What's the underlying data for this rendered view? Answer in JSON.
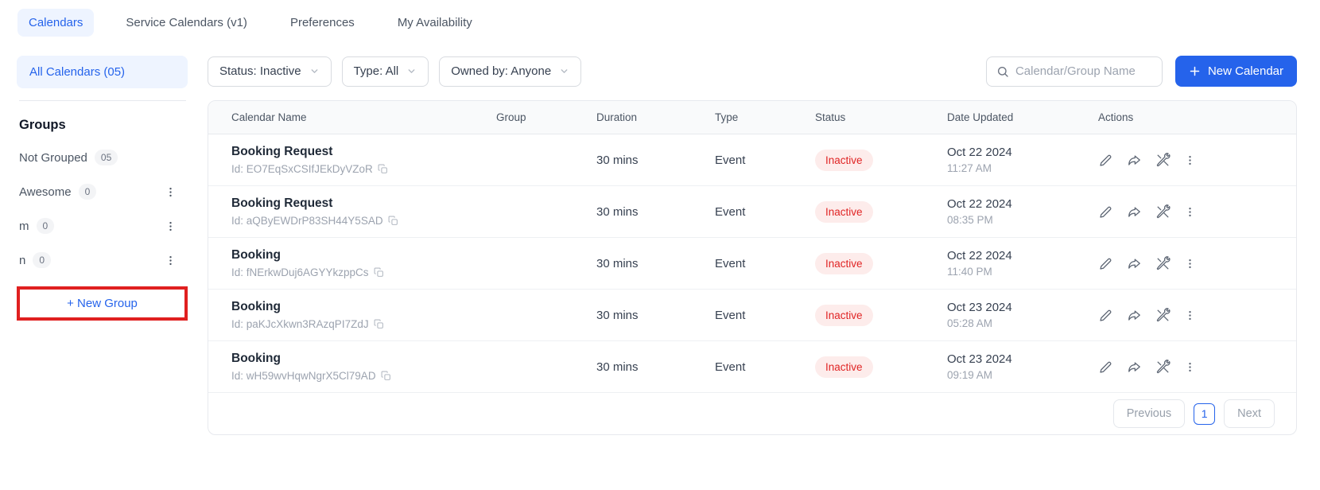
{
  "nav": {
    "tabs": [
      {
        "label": "Calendars",
        "active": true
      },
      {
        "label": "Service Calendars (v1)",
        "active": false
      },
      {
        "label": "Preferences",
        "active": false
      },
      {
        "label": "My Availability",
        "active": false
      }
    ]
  },
  "sidebar": {
    "all_calendars_label": "All Calendars (05)",
    "groups_heading": "Groups",
    "groups": [
      {
        "name": "Not Grouped",
        "count": "05",
        "has_menu": false
      },
      {
        "name": "Awesome",
        "count": "0",
        "has_menu": true
      },
      {
        "name": "m",
        "count": "0",
        "has_menu": true
      },
      {
        "name": "n",
        "count": "0",
        "has_menu": true
      }
    ],
    "new_group_label": "+ New Group"
  },
  "filters": {
    "status": "Status: Inactive",
    "type": "Type: All",
    "owned_by": "Owned by: Anyone",
    "search_placeholder": "Calendar/Group Name"
  },
  "new_calendar_label": "New Calendar",
  "table": {
    "columns": [
      "Calendar Name",
      "Group",
      "Duration",
      "Type",
      "Status",
      "Date Updated",
      "Actions"
    ],
    "rows": [
      {
        "name": "Booking Request",
        "id": "Id: EO7EqSxCSIfJEkDyVZoR",
        "group": "",
        "duration": "30 mins",
        "type": "Event",
        "status": "Inactive",
        "date": "Oct 22 2024",
        "time": "11:27 AM"
      },
      {
        "name": "Booking Request",
        "id": "Id: aQByEWDrP83SH44Y5SAD",
        "group": "",
        "duration": "30 mins",
        "type": "Event",
        "status": "Inactive",
        "date": "Oct 22 2024",
        "time": "08:35 PM"
      },
      {
        "name": "Booking",
        "id": "Id: fNErkwDuj6AGYYkzppCs",
        "group": "",
        "duration": "30 mins",
        "type": "Event",
        "status": "Inactive",
        "date": "Oct 22 2024",
        "time": "11:40 PM"
      },
      {
        "name": "Booking",
        "id": "Id: paKJcXkwn3RAzqPI7ZdJ",
        "group": "",
        "duration": "30 mins",
        "type": "Event",
        "status": "Inactive",
        "date": "Oct 23 2024",
        "time": "05:28 AM"
      },
      {
        "name": "Booking",
        "id": "Id: wH59wvHqwNgrX5Cl79AD",
        "group": "",
        "duration": "30 mins",
        "type": "Event",
        "status": "Inactive",
        "date": "Oct 23 2024",
        "time": "09:19 AM"
      }
    ]
  },
  "pagination": {
    "previous": "Previous",
    "page": "1",
    "next": "Next"
  },
  "colors": {
    "accent_blue": "#2563eb",
    "accent_blue_bg": "#eef4ff",
    "status_inactive_text": "#e02424",
    "status_inactive_bg": "#fdeceb",
    "annotation_red": "#e02020"
  }
}
